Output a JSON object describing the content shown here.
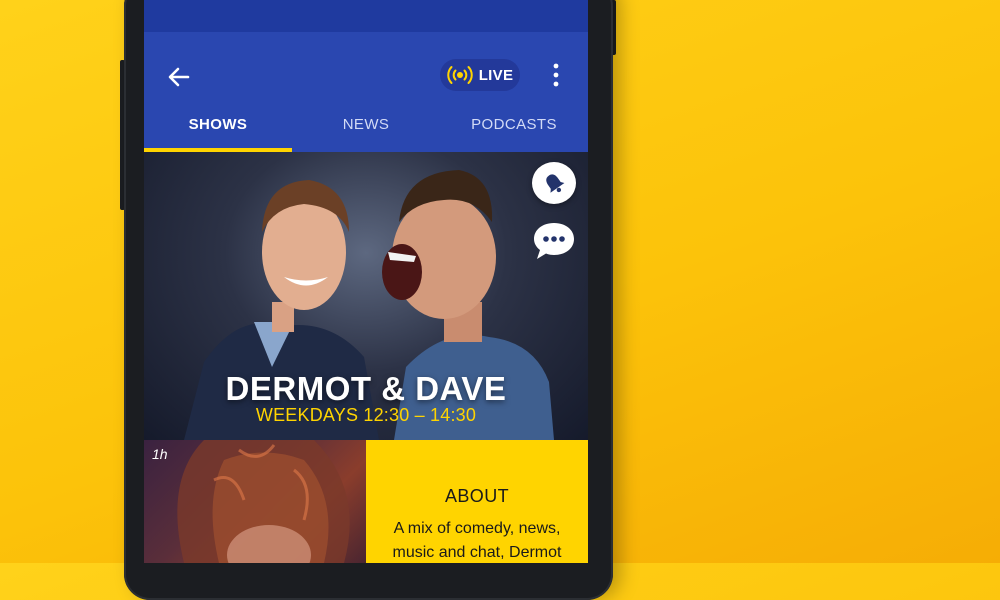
{
  "colors": {
    "background_yellow": "#fcc30a",
    "toolbar_blue": "#2a47b0",
    "status_blue": "#1f3a9f",
    "accent_yellow": "#ffd400",
    "live_icon": "#ffd400"
  },
  "toolbar": {
    "back_icon": "arrow-left-icon",
    "live_label": "LIVE",
    "live_icon": "broadcast-icon",
    "more_icon": "more-vertical-icon"
  },
  "tabs": [
    {
      "label": "SHOWS",
      "active": true
    },
    {
      "label": "NEWS",
      "active": false
    },
    {
      "label": "PODCASTS",
      "active": false
    }
  ],
  "hero": {
    "title": "DERMOT & DAVE",
    "schedule": "WEEKDAYS 12:30 – 14:30",
    "bell_icon": "bell-icon",
    "chat_icon": "chat-bubble-icon"
  },
  "next_show": {
    "duration": "1h"
  },
  "about": {
    "heading": "ABOUT",
    "text": "A mix of comedy, news, music and chat, Dermot"
  }
}
